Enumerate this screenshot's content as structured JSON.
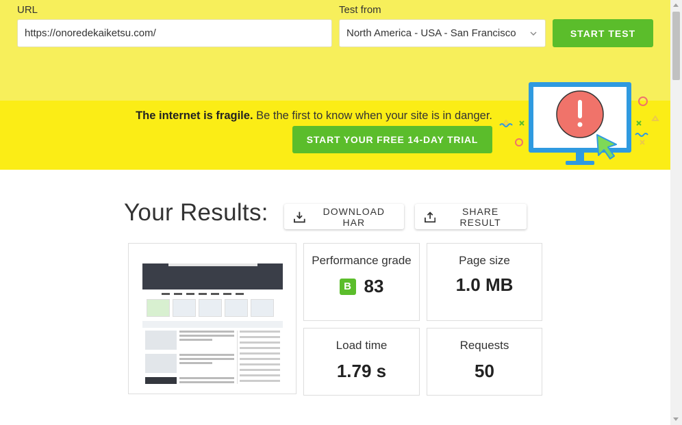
{
  "form": {
    "url_label": "URL",
    "url_value": "https://onoredekaiketsu.com/",
    "test_from_label": "Test from",
    "test_from_value": "North America - USA - San Francisco",
    "start_button": "START TEST"
  },
  "promo": {
    "bold": "The internet is fragile.",
    "text": "Be the first to know when your site is in danger.",
    "trial_button": "START YOUR FREE 14-DAY TRIAL"
  },
  "results": {
    "title": "Your Results:",
    "download_button": "DOWNLOAD HAR",
    "share_button": "SHARE RESULT",
    "performance": {
      "label": "Performance grade",
      "grade": "B",
      "score": "83"
    },
    "page_size": {
      "label": "Page size",
      "value": "1.0 MB"
    },
    "load_time": {
      "label": "Load time",
      "value": "1.79 s"
    },
    "requests": {
      "label": "Requests",
      "value": "50"
    }
  },
  "colors": {
    "top_band": "#f7ef5b",
    "promo_band": "#fbed16",
    "accent_green": "#5bbd2b",
    "alert_red": "#f0736a",
    "monitor_blue": "#2f9ae0"
  },
  "icons": [
    "chevron-down-icon",
    "download-icon",
    "share-icon",
    "alert-monitor-illustration",
    "cursor-icon"
  ]
}
